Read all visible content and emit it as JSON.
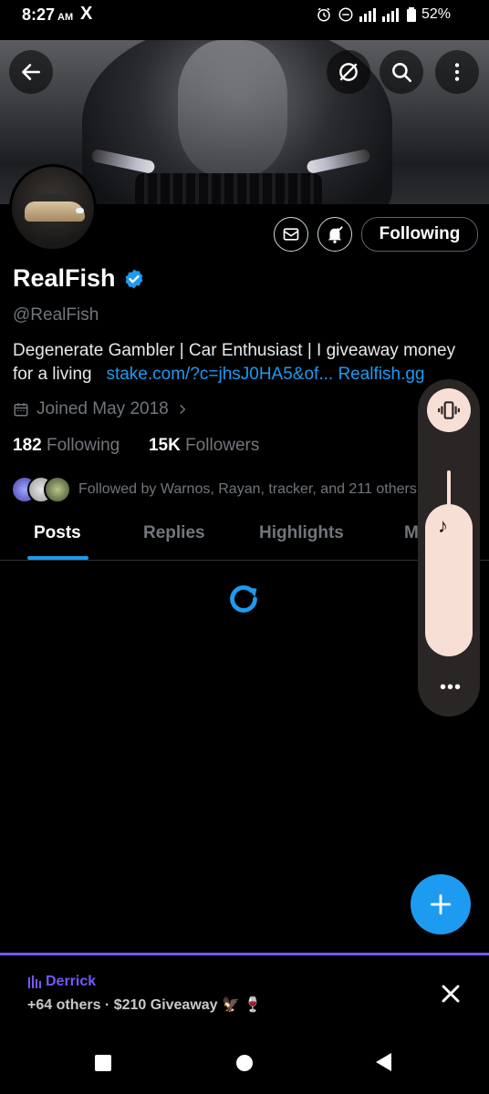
{
  "status_bar": {
    "time": "8:27",
    "ampm": "AM",
    "app_icon": "X",
    "battery": "52%",
    "indicators": [
      "alarm-icon",
      "dnd-icon",
      "wifi-calling-icon",
      "signal-icon",
      "battery-icon"
    ]
  },
  "profile": {
    "name": "RealFish",
    "handle": "@RealFish",
    "bio_text": "Degenerate Gambler | Car Enthusiast | I giveaway money for a living",
    "bio_link_1": "stake.com/?c=jhsJ0HA5&of...",
    "bio_link_2": "Realfish.gg",
    "joined": "Joined May 2018",
    "following_count": "182",
    "following_label": "Following",
    "followers_count": "15K",
    "followers_label": "Followers",
    "followed_by": "Followed by Warnos, Rayan, tracker, and 211 others",
    "follow_button": "Following"
  },
  "tabs": [
    {
      "label": "Posts",
      "active": true
    },
    {
      "label": "Replies",
      "active": false
    },
    {
      "label": "Highlights",
      "active": false
    },
    {
      "label": "M",
      "active": false
    }
  ],
  "space": {
    "host": "Derrick",
    "title": "+64 others · $210 Giveaway 🦅 🍷"
  },
  "volume": {
    "level": 0.82
  },
  "colors": {
    "accent": "#1d9bf0",
    "space": "#7856ff",
    "volume_panel": "#f8dfd6"
  }
}
